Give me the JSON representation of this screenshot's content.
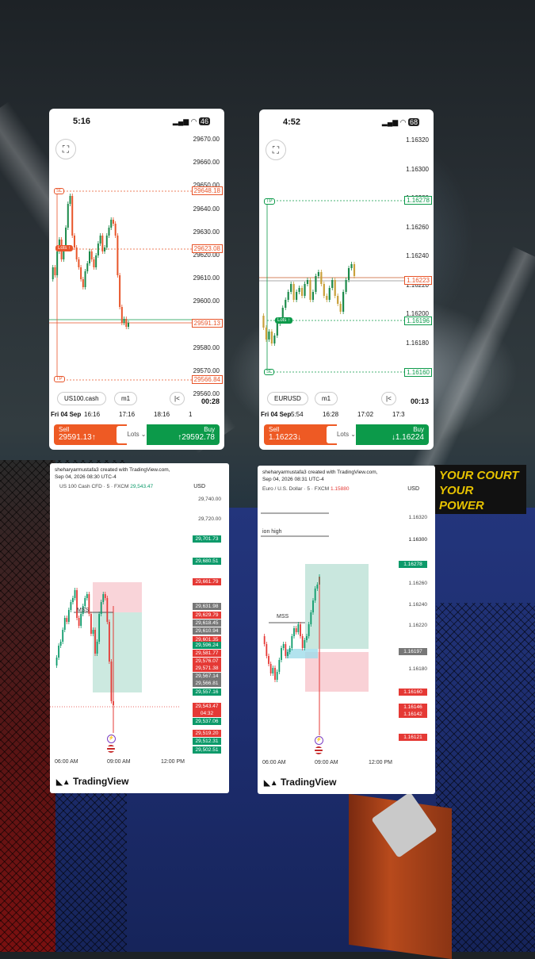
{
  "phone1": {
    "time": "5:16",
    "battery": "46",
    "symbol": "US100.cash",
    "timeframe": "m1",
    "prices": [
      "29670.00",
      "29660.00",
      "29650.00",
      "29640.00",
      "29630.00",
      "29620.00",
      "29610.00",
      "29600.00",
      "29590.00",
      "29580.00",
      "29570.00",
      "29560.00"
    ],
    "levels": {
      "tp": "29648.18",
      "entry": "29623.08",
      "current": "29591.13",
      "sl": "29566.84"
    },
    "labels": {
      "tp": "SL",
      "entry": "Lots",
      "sl": "TP"
    },
    "countdown": "00:28",
    "date": "Fri 04 Sep",
    "times": [
      "16:16",
      "17:16",
      "18:16",
      "1"
    ],
    "sell": {
      "label": "Sell",
      "price": "29591.13↑"
    },
    "buy": {
      "label": "Buy",
      "price": "↑29592.78"
    },
    "lots": "Lots"
  },
  "phone2": {
    "time": "4:52",
    "battery": "68",
    "symbol": "EURUSD",
    "timeframe": "m1",
    "prices": [
      "1.16320",
      "1.16300",
      "1.16280",
      "1.16260",
      "1.16240",
      "1.16220",
      "1.16200",
      "1.16180",
      "1.16160"
    ],
    "levels": {
      "tp": "1.16278",
      "current": "1.16223",
      "entry": "1.16196",
      "sl": "1.16160"
    },
    "labels": {
      "tp": "TP",
      "entry": "Lots",
      "sl": "SL"
    },
    "countdown": "00:13",
    "date": "Fri 04 Sep",
    "times": [
      "5:54",
      "16:28",
      "17:02",
      "17:3"
    ],
    "sell": {
      "label": "Sell",
      "price": "1.16223↓"
    },
    "buy": {
      "label": "Buy",
      "price": "↓1.16224"
    },
    "lots": "Lots"
  },
  "tv1": {
    "created": "sheharyarmustafa3 created with TradingView.com,",
    "date": "Sep 04, 2026 08:30 UTC-4",
    "symbol": "US 100 Cash CFD · 5 · FXCM",
    "symbol_price": "29,543.47",
    "currency": "USD",
    "axis": [
      "29,740.00",
      "29,720.00"
    ],
    "pills": [
      {
        "v": "29,701.73",
        "c": "#0c9a6a"
      },
      {
        "v": "29,680.51",
        "c": "#0c9a6a"
      },
      {
        "v": "29,661.79",
        "c": "#e53935"
      },
      {
        "v": "29,631.98",
        "c": "#777777"
      },
      {
        "v": "29,629.79",
        "c": "#e53935"
      },
      {
        "v": "29,618.45",
        "c": "#777777"
      },
      {
        "v": "29,610.94",
        "c": "#777777"
      },
      {
        "v": "29,601.35",
        "c": "#e53935"
      },
      {
        "v": "29,596.24",
        "c": "#0c9a6a"
      },
      {
        "v": "29,581.77",
        "c": "#e53935"
      },
      {
        "v": "29,576.07",
        "c": "#e53935"
      },
      {
        "v": "29,571.38",
        "c": "#e53935"
      },
      {
        "v": "29,567.14",
        "c": "#777777"
      },
      {
        "v": "29,566.81",
        "c": "#777777"
      },
      {
        "v": "29,557.16",
        "c": "#0c9a6a"
      },
      {
        "v": "29,543.47",
        "c": "#e53935"
      },
      {
        "v": "04:32",
        "c": "#e53935"
      },
      {
        "v": "29,537.06",
        "c": "#0c9a6a"
      },
      {
        "v": "29,519.20",
        "c": "#e53935"
      },
      {
        "v": "29,512.31",
        "c": "#0c9a6a"
      },
      {
        "v": "29,502.51",
        "c": "#0c9a6a"
      }
    ],
    "mss": "MSS",
    "times": [
      "06:00 AM",
      "09:00 AM",
      "12:00 PM"
    ],
    "logo": "TradingView"
  },
  "tv2": {
    "created": "sheharyarmustafa3 created with TradingView.com,",
    "date": "Sep 04, 2026 08:31 UTC-4",
    "symbol": "Euro / U.S. Dollar · 5 · FXCM",
    "symbol_price": "1.15880",
    "currency": "USD",
    "axis": [
      "1.16320",
      "1.16300",
      "1.16260",
      "1.16240",
      "1.16220",
      "1.16180"
    ],
    "pills": [
      {
        "v": "1.16278",
        "c": "#0c9a6a"
      },
      {
        "v": "1.16197",
        "c": "#777777"
      },
      {
        "v": "1.16160",
        "c": "#e53935"
      },
      {
        "v": "1.16146",
        "c": "#e53935"
      },
      {
        "v": "1.16142",
        "c": "#e53935"
      },
      {
        "v": "1.16121",
        "c": "#e53935"
      }
    ],
    "session": "ion high",
    "mss": "MSS",
    "times": [
      "06:00 AM",
      "09:00 AM",
      "12:00 PM"
    ],
    "logo": "TradingView"
  },
  "banner": "YOUR COURT YOUR POWER"
}
